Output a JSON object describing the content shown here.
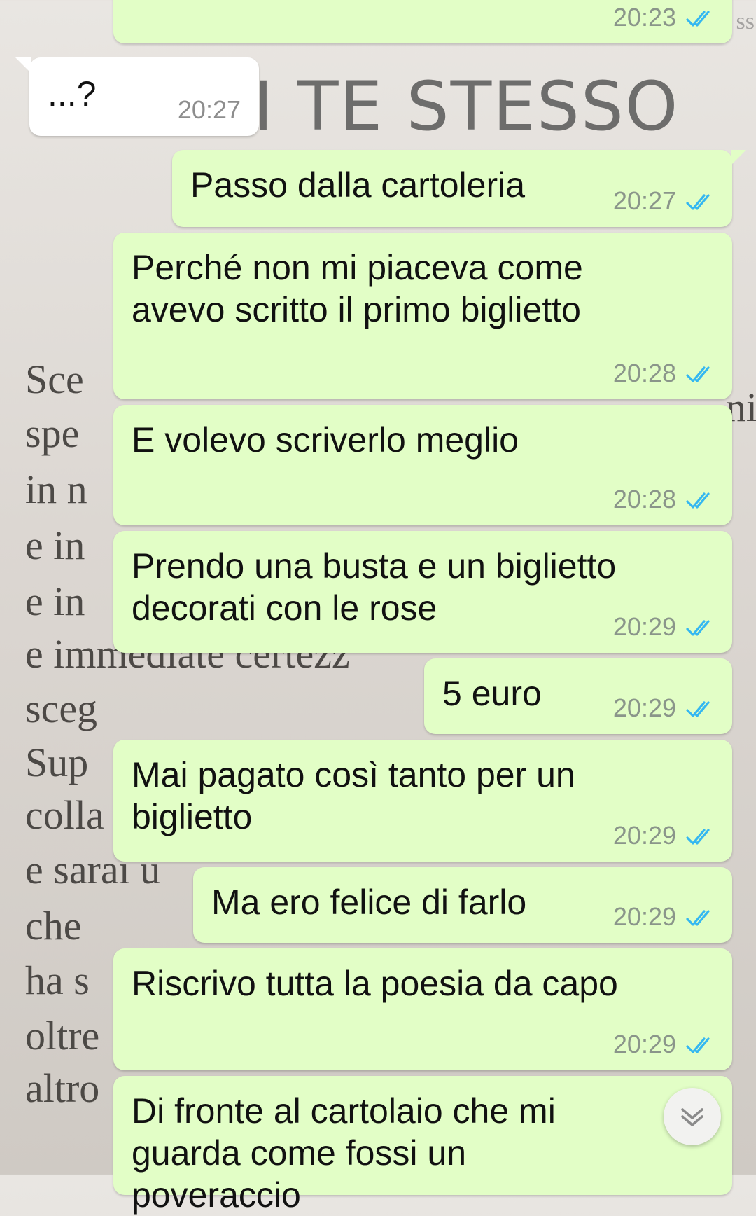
{
  "background": {
    "title": "I TE STESSO",
    "top_right_fragment": "ss",
    "right_fragment": "ni",
    "lines": [
      "Sce",
      "spe",
      "in n",
      "e in",
      "e in",
      "e immediate certezz",
      "sceg",
      "Sup",
      "colla for",
      "e sarai u",
      "che",
      "ha s",
      "oltre",
      "altro"
    ]
  },
  "messages": [
    {
      "text": "",
      "time": "20:23"
    },
    {
      "text": "...?",
      "time": "20:27"
    },
    {
      "text": "Passo dalla cartoleria",
      "time": "20:27"
    },
    {
      "text": "Perché non mi piaceva come avevo scritto il primo biglietto",
      "time": "20:28"
    },
    {
      "text": "E volevo scriverlo meglio",
      "time": "20:28"
    },
    {
      "text": "Prendo una busta e un biglietto decorati con le rose",
      "time": "20:29"
    },
    {
      "text": "5 euro",
      "time": "20:29"
    },
    {
      "text": "Mai pagato così tanto per un biglietto",
      "time": "20:29"
    },
    {
      "text": "Ma ero felice di farlo",
      "time": "20:29"
    },
    {
      "text": "Riscrivo tutta la poesia da capo",
      "time": "20:29"
    },
    {
      "text": "Di fronte al cartolaio che mi guarda come fossi un poveraccio",
      "time": ""
    }
  ],
  "colors": {
    "outgoing_bubble": "#e2fec6",
    "incoming_bubble": "#ffffff",
    "read_ticks": "#34b7f1"
  },
  "icons": {
    "read_receipt": "double-check-icon",
    "scroll_down": "chevron-down-icon"
  }
}
